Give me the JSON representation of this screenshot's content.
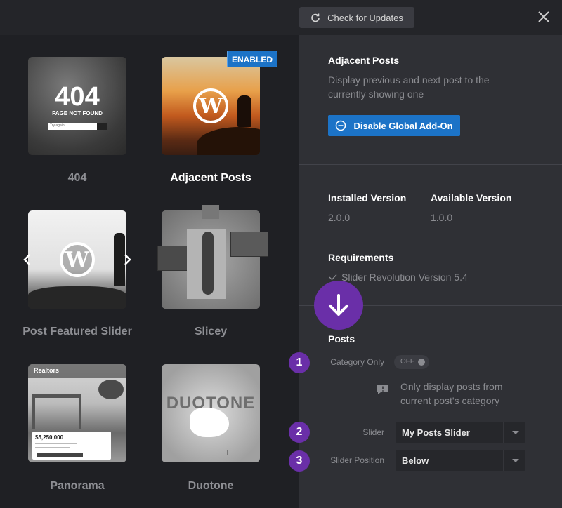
{
  "topbar": {
    "check_updates": "Check for Updates"
  },
  "grid": {
    "items": [
      {
        "label": "404",
        "art_title": "404",
        "art_sub": "PAGE NOT FOUND",
        "art_search": "Try again..."
      },
      {
        "label": "Adjacent Posts",
        "badge": "ENABLED"
      },
      {
        "label": "Post Featured Slider"
      },
      {
        "label": "Slicey"
      },
      {
        "label": "Panorama",
        "art_brand": "Realtors",
        "art_price": "$5,250,000"
      },
      {
        "label": "Duotone",
        "art_title": "DUOTONE"
      }
    ]
  },
  "details": {
    "title": "Adjacent Posts",
    "description": "Display previous and next post to the currently showing one",
    "disable_button": "Disable Global Add-On",
    "installed_label": "Installed Version",
    "installed_value": "2.0.0",
    "available_label": "Available Version",
    "available_value": "1.0.0",
    "requirements_label": "Requirements",
    "requirement_item": "Slider Revolution Version 5.4"
  },
  "settings": {
    "section_title": "Posts",
    "category_only_label": "Category Only",
    "category_only_value": "OFF",
    "category_info": "Only display posts from current post's category",
    "slider_label": "Slider",
    "slider_value": "My Posts Slider",
    "slider_position_label": "Slider Position",
    "slider_position_value": "Below",
    "step_numbers": [
      "1",
      "2",
      "3"
    ]
  },
  "colors": {
    "accent_blue": "#1c73c7",
    "step_purple": "#6a2fa8"
  }
}
